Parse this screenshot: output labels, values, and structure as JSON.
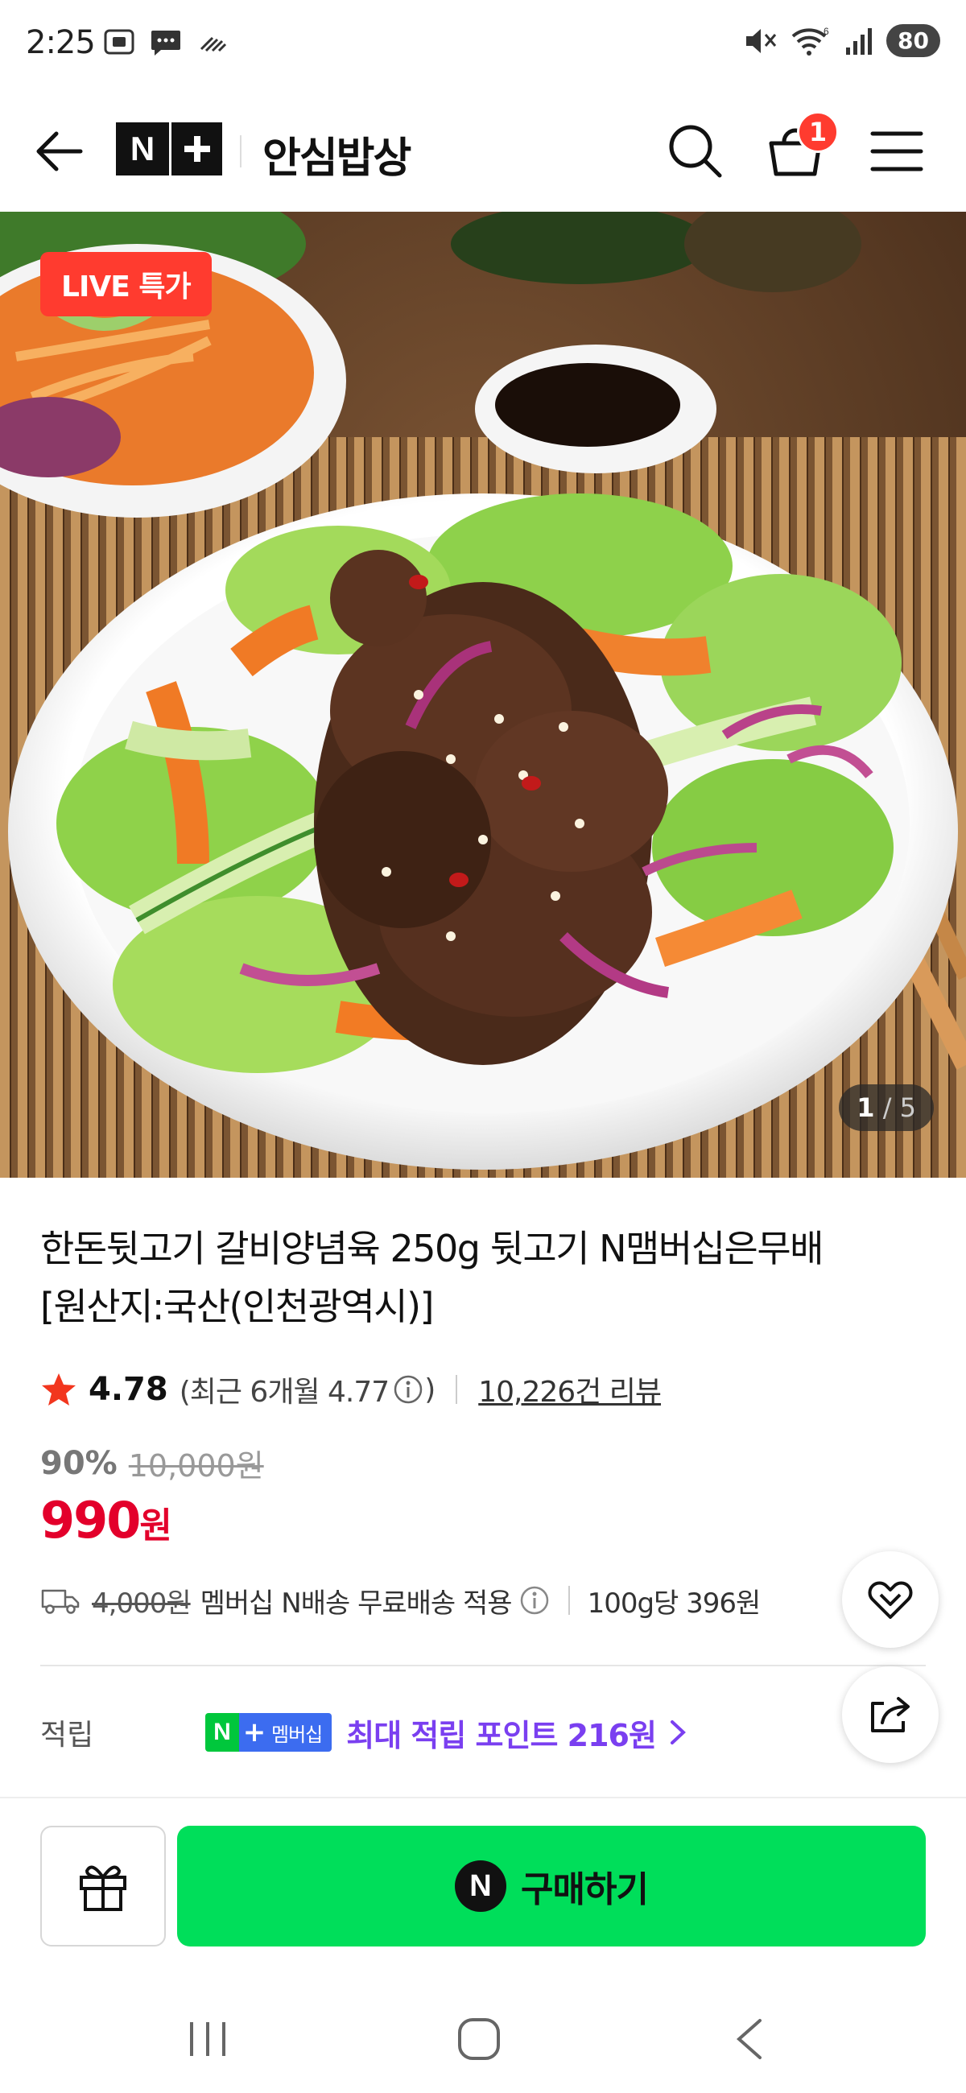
{
  "status_bar": {
    "time": "2:25",
    "battery": "80",
    "left_icons": [
      "screenshot-icon",
      "message-icon",
      "wifi-calling-icon"
    ],
    "right_icons": [
      "mute-icon",
      "wifi-6-icon",
      "signal-icon"
    ]
  },
  "header": {
    "logo_n": "N",
    "brand_title": "안심밥상",
    "cart_badge": "1"
  },
  "hero": {
    "live_badge": "LIVE 특가",
    "page_current": "1",
    "page_separator": "/",
    "page_total": "5"
  },
  "product": {
    "title_line1": "한돈뒷고기 갈비양념육 250g 뒷고기 N맴버십은무배",
    "title_line2": "[원산지:국산(인천광역시)]",
    "rating": "4.78",
    "recent_rating_open": "(최근 6개월 4.77",
    "recent_rating_close": ")",
    "review_count": "10,226건 리뷰",
    "discount_percent": "90%",
    "original_price": "10,000원",
    "sale_price": "990",
    "sale_unit": "원",
    "shipping_original": "4,000원",
    "shipping_text": "멤버십 N배송 무료배송 적용",
    "unit_price": "100g당 396원"
  },
  "points": {
    "label": "적립",
    "badge_n": "N",
    "badge_plus": "+",
    "badge_text": "멤버십",
    "text": "최대 적립 포인트 216원"
  },
  "bottom_bar": {
    "buy_icon_letter": "N",
    "buy_label": "구매하기"
  },
  "colors": {
    "sale_red": "#e3002b",
    "buy_green": "#00de5a",
    "points_purple": "#7a3ff0",
    "live_red": "#ff3b2f"
  }
}
